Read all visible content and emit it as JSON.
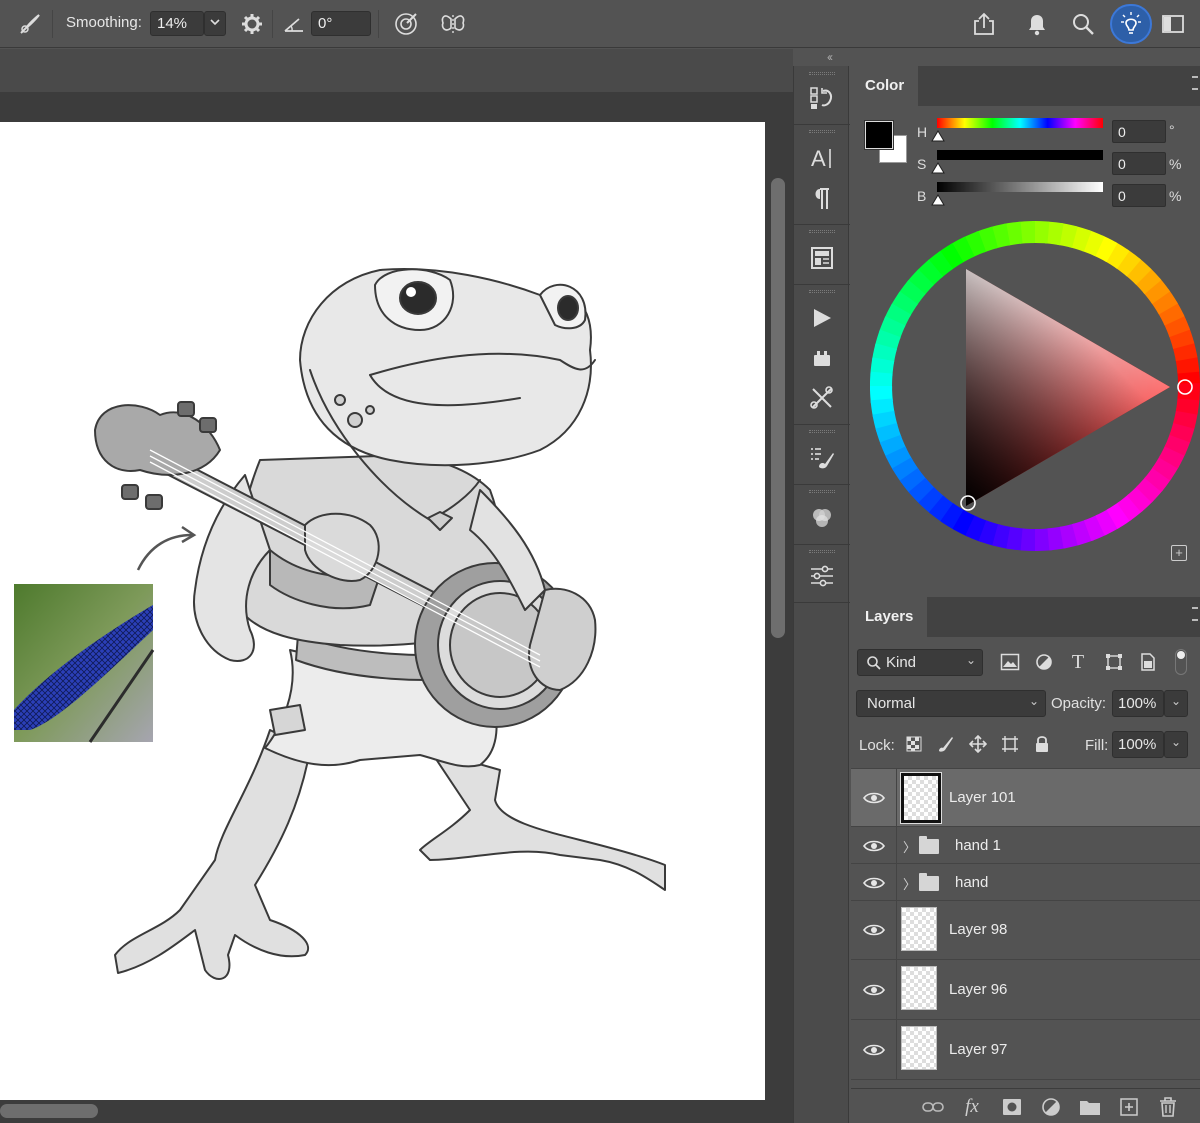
{
  "options_bar": {
    "smoothing_label": "Smoothing:",
    "smoothing_value": "14%",
    "angle_value": "0°",
    "icons": [
      "brush-tool-icon",
      "chevron-down-icon",
      "gear-icon",
      "angle-icon",
      "pressure-icon",
      "symmetry-icon",
      "share-icon",
      "bell-icon",
      "search-icon",
      "lightbulb-icon",
      "workspace-icon"
    ]
  },
  "color_panel": {
    "tab": "Color",
    "h_label": "H",
    "s_label": "S",
    "b_label": "B",
    "h_value": "0",
    "s_value": "0",
    "b_value": "0",
    "h_unit": "°",
    "s_unit": "%",
    "b_unit": "%",
    "foreground_color": "#000000",
    "background_color": "#ffffff"
  },
  "layers_panel": {
    "tab": "Layers",
    "filter_kind": "Kind",
    "blend_mode": "Normal",
    "opacity_label": "Opacity:",
    "opacity_value": "100%",
    "lock_label": "Lock:",
    "fill_label": "Fill:",
    "fill_value": "100%",
    "layers": [
      {
        "name": "Layer 101",
        "type": "layer",
        "selected": true
      },
      {
        "name": "hand 1",
        "type": "group",
        "selected": false
      },
      {
        "name": "hand",
        "type": "group",
        "selected": false
      },
      {
        "name": "Layer 98",
        "type": "layer",
        "selected": false
      },
      {
        "name": "Layer 96",
        "type": "layer",
        "selected": false
      },
      {
        "name": "Layer 97",
        "type": "layer",
        "selected": false
      }
    ]
  },
  "colors": {
    "accent": "#3c78d8",
    "panel": "#535353",
    "canvas": "#ffffff"
  }
}
